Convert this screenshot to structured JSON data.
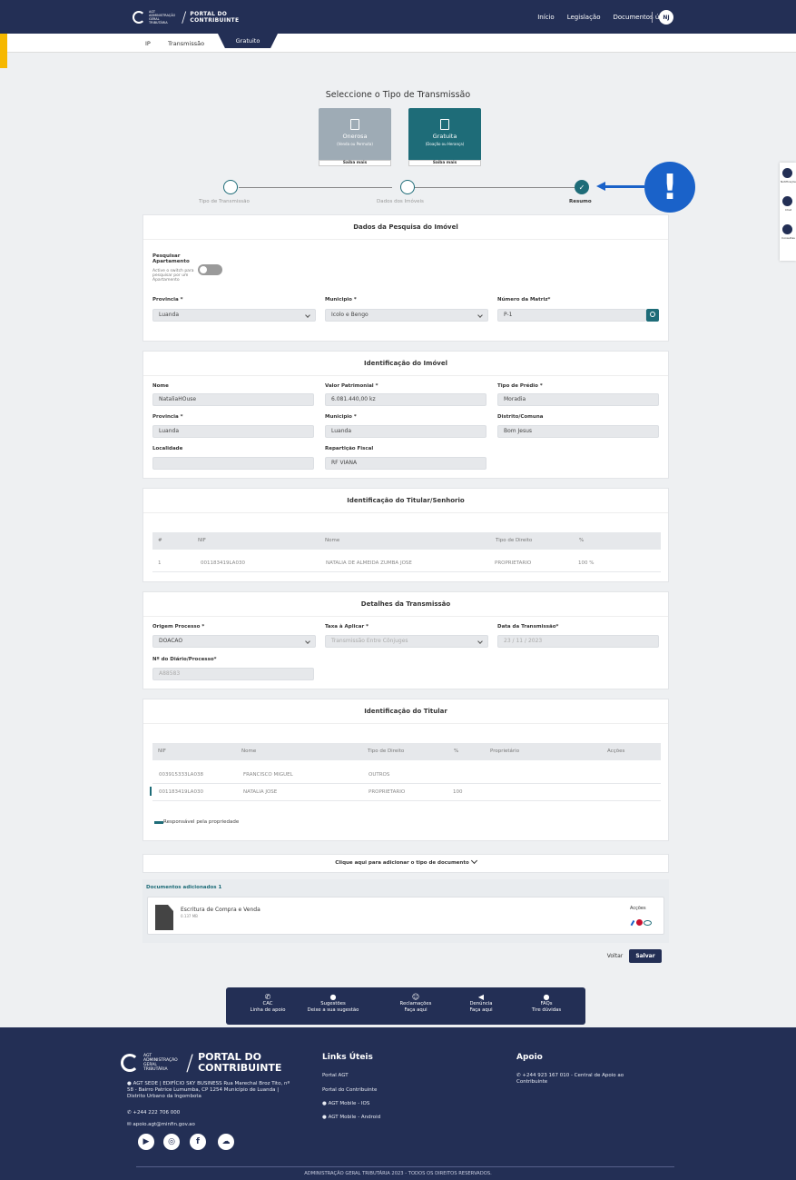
{
  "header": {
    "logo_small": "AGT ADMINISTRAÇÃO GERAL TRIBUTÁRIA",
    "logo_title_1": "PORTAL DO",
    "logo_title_2": "CONTRIBUINTE",
    "nav": [
      "Início",
      "Legislação",
      "Documentos úteis"
    ],
    "user_initials": "NJ"
  },
  "subnav": {
    "tabs": [
      "IP",
      "Transmissão",
      "Gratuito"
    ]
  },
  "selection": {
    "title": "Seleccione o Tipo de Transmissão",
    "cards": [
      {
        "title": "Onerosa",
        "subtitle": "(Venda ou Permuta)",
        "more": "Saiba mais",
        "color": "#9eabb5"
      },
      {
        "title": "Gratuita",
        "subtitle": "(Doação ou Herança)",
        "more": "Saiba mais",
        "color": "#1e6c78"
      }
    ]
  },
  "steps": [
    "Tipo de Transmissão",
    "Dados dos Imóveis",
    "Resumo"
  ],
  "alert_symbol": "!",
  "side_widget": [
    "Notificações",
    "Chat",
    "Consultas"
  ],
  "pesquisa": {
    "title": "Dados da Pesquisa do Imóvel",
    "toggle_label": "Pesquisar Apartamento",
    "toggle_hint": "Active o switch para pesquisar por um Apartamento",
    "provincia_label": "Provincia *",
    "provincia": "Luanda",
    "municipio_label": "Municipio *",
    "municipio": "Icolo e Bengo",
    "matriz_label": "Número da Matriz*",
    "matriz": "P-1"
  },
  "imovel": {
    "title": "Identificação do Imóvel",
    "nome_label": "Nome",
    "nome": "NataliaHOuse",
    "valor_label": "Valor Patrimonial *",
    "valor": "6.081.440,00 kz",
    "tipo_label": "Tipo de Prédio *",
    "tipo": "Moradia",
    "provincia_label": "Provincia *",
    "provincia": "Luanda",
    "municipio_label": "Municipio *",
    "municipio": "Luanda",
    "distrito_label": "Distrito/Comuna",
    "distrito": "Bom Jesus",
    "localidade_label": "Localidade",
    "localidade": "",
    "reparticao_label": "Repartição Fiscal",
    "reparticao": "RF VIANA"
  },
  "senhorio": {
    "title": "Identificação do Titular/Senhorio",
    "headers": [
      "#",
      "NIF",
      "Nome",
      "Tipo de Direito",
      "%"
    ],
    "rows": [
      [
        "1",
        "001183419LA030",
        "NATALIA DE ALMEIDA ZUMBA JOSE",
        "PROPRIETARIO",
        "100 %"
      ]
    ]
  },
  "transmissao": {
    "title": "Detalhes da Transmissão",
    "origem_label": "Origem Processo *",
    "origem": "DOACAO",
    "taxa_label": "Taxa à Aplicar *",
    "taxa": "Transmissão Entre Cônjuges",
    "data_label": "Data da Transmissão*",
    "data": "23 / 11 / 2023",
    "diario_label": "Nº do Diário/Processo*",
    "diario": "A88583"
  },
  "titular": {
    "title": "Identificação do Titular",
    "headers": [
      "NIF",
      "Nome",
      "Tipo de Direito",
      "%",
      "Proprietário",
      "Acções"
    ],
    "rows": [
      [
        "003915333LA038",
        "FRANCISCO MIGUEL",
        "OUTROS",
        "",
        "",
        ""
      ],
      [
        "001183419LA030",
        "NATALIA JOSE",
        "PROPRIETARIO",
        "100",
        "",
        ""
      ]
    ],
    "legend": "Responsável pela propriedade"
  },
  "documentos": {
    "add_label": "Clique aqui para adicionar o tipo de documento",
    "added_label": "Documentos adicionados 1",
    "doc_name": "Escritura de Compra e Venda",
    "doc_size": "0.137 MB",
    "acoes": "Acções"
  },
  "actions": {
    "back": "Voltar",
    "save": "Salvar"
  },
  "help": [
    {
      "icon": "phone-icon",
      "glyph": "✆",
      "title": "CAC",
      "sub": "Linha de apoio"
    },
    {
      "icon": "chat-icon",
      "glyph": "●",
      "title": "Sugestões",
      "sub": "Deixe a sua sugestão"
    },
    {
      "icon": "smile-icon",
      "glyph": "☺",
      "title": "Reclamações",
      "sub": "Faça aqui"
    },
    {
      "icon": "megaphone-icon",
      "glyph": "◀",
      "title": "Denúncia",
      "sub": "Faça aqui"
    },
    {
      "icon": "faq-icon",
      "glyph": "●",
      "title": "FAQs",
      "sub": "Tire dúvidas"
    }
  ],
  "footer": {
    "logo_small": "AGT ADMINISTRAÇÃO GERAL TRIBUTÁRIA",
    "logo_title_1": "PORTAL DO",
    "logo_title_2": "CONTRIBUINTE",
    "address": "AGT SEDE | EDIFÍCIO SKY BUSINESS Rua Marechal Broz Tito, nº 58 - Bairro Patrice Lumumba, CP 1254 Município de Luanda | Distrito Urbano da Ingombota",
    "phone": "+244 222 706 000",
    "email": "apoio.agt@minfin.gov.ao",
    "links_title": "Links Úteis",
    "links": [
      "Portal AGT",
      "Portal do Contribuinte",
      "AGT Mobile - IOS",
      "AGT Mobile - Android"
    ],
    "apoio_title": "Apoio",
    "apoio": "+244 923 167 010 - Central de Apoio ao Contribuinte",
    "copyright": "ADMINISTRAÇÃO GERAL TRIBUTÁRIA 2023 - TODOS OS DIREITOS RESERVADOS."
  },
  "colors": {
    "navy": "#232f55",
    "teal": "#1e6c78",
    "blue_alert": "#1a62c9",
    "yellow": "#f6b800"
  }
}
